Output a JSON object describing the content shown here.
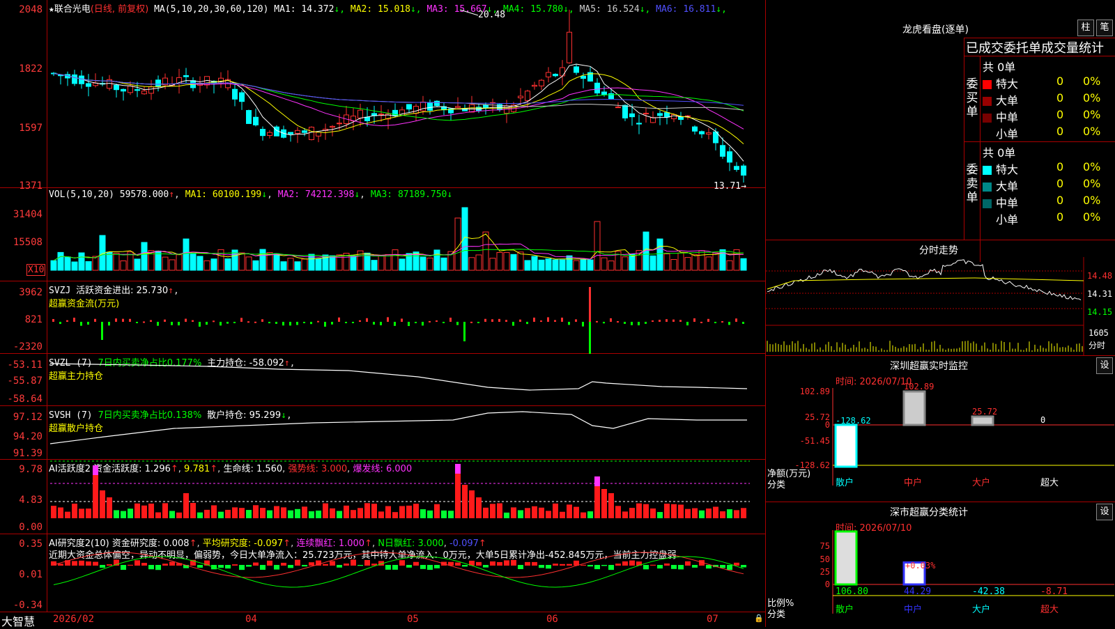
{
  "main": {
    "stock_name": "联合光电",
    "chart_mode": "(日线, 前复权)",
    "ma_label": "MA(5,10,20,30,60,120)",
    "ma_values": [
      {
        "name": "MA1",
        "value": "14.372",
        "arrow": "↓",
        "color": "#ffffff"
      },
      {
        "name": "MA2",
        "value": "15.018",
        "arrow": "↓",
        "color": "#ffff00"
      },
      {
        "name": "MA3",
        "value": "15.667",
        "arrow": "↓",
        "color": "#ff33ff"
      },
      {
        "name": "MA4",
        "value": "15.780",
        "arrow": "↓",
        "color": "#00ff00"
      },
      {
        "name": "MA5",
        "value": "16.524",
        "arrow": "↓",
        "color": "#cccccc"
      },
      {
        "name": "MA6",
        "value": "16.811",
        "arrow": "↓",
        "color": "#5050ff"
      }
    ],
    "y_ticks": [
      "2048",
      "1822",
      "1597",
      "1371"
    ],
    "high_label": "20.48",
    "low_label": "13.71"
  },
  "vol": {
    "label": "VOL(5,10,20)",
    "value": "59578.000",
    "ma1": "MA1: 60100.199",
    "ma2": "MA2: 74212.398",
    "ma3": "MA3: 87189.750",
    "y_ticks": [
      "31404",
      "15508"
    ],
    "unit": "X10"
  },
  "svzj": {
    "label": "SVZJ",
    "text": "活跃资金进出: 25.730",
    "subtitle": "超赢资金流(万元)",
    "y_ticks": [
      "3962",
      "821",
      "-2320"
    ]
  },
  "svzl": {
    "label": "SVZL (7)",
    "text1": "7日内买卖净占比0.177%",
    "text2": "主力持仓: -58.092",
    "subtitle": "超赢主力持仓",
    "y_ticks": [
      "-53.11",
      "-55.87",
      "-58.64"
    ]
  },
  "svsh": {
    "label": "SVSH (7)",
    "text1": "7日内买卖净占比0.138%",
    "text2": "散户持仓: 95.299",
    "subtitle": "超赢散户持仓",
    "y_ticks": [
      "97.12",
      "94.20",
      "91.39"
    ]
  },
  "ai1": {
    "label": "AI活跃度2",
    "v1": "资金活跃度: 1.296",
    "v2": "9.781",
    "v3": "生命线: 1.560",
    "v4": "强势线: 3.000",
    "v5": "爆发线: 6.000",
    "y_ticks": [
      "9.78",
      "4.83",
      "0.00"
    ]
  },
  "ai2": {
    "label": "AI研究度2(10)",
    "v1": "资金研究度: 0.008",
    "v2": "平均研究度: -0.097",
    "v3": "连续飘红: 1.000",
    "v4": "N日飘红: 3.000",
    "v5": "-0.097",
    "commentary": "近期大资金总体偏空，异动不明显，偏弱势，今日大单净流入：25.723万元，其中特大单净流入：0万元，大单5日累计净出-452.845万元，当前主力控盘弱",
    "y_ticks": [
      "0.35",
      "0.01",
      "-0.34"
    ]
  },
  "x_axis": {
    "app_name": "大智慧",
    "labels": [
      "2026/02",
      "04",
      "05",
      "06",
      "07"
    ]
  },
  "right": {
    "lhb_title": "龙虎看盘(逐单)",
    "btn1": "柱",
    "btn2": "笔",
    "header": "已成交委托单成交量统计",
    "buy": {
      "side": "委买单",
      "total": "共 0单",
      "rows": [
        {
          "label": "特大",
          "count": "0",
          "pct": "0%",
          "color": "#ff0000"
        },
        {
          "label": "大单",
          "count": "0",
          "pct": "0%",
          "color": "#990000"
        },
        {
          "label": "中单",
          "count": "0",
          "pct": "0%",
          "color": "#770000"
        },
        {
          "label": "小单",
          "count": "0",
          "pct": "0%",
          "color": "#000000"
        }
      ]
    },
    "sell": {
      "side": "委卖单",
      "total": "共 0单",
      "rows": [
        {
          "label": "特大",
          "count": "0",
          "pct": "0%",
          "color": "#00ffff"
        },
        {
          "label": "大单",
          "count": "0",
          "pct": "0%",
          "color": "#008888"
        },
        {
          "label": "中单",
          "count": "0",
          "pct": "0%",
          "color": "#006666"
        },
        {
          "label": "小单",
          "count": "0",
          "pct": "0%",
          "color": "#000000"
        }
      ]
    },
    "intraday": {
      "title": "分时走势",
      "prices": [
        "14.48",
        "14.31",
        "14.15"
      ],
      "vol": "1605",
      "vol_unit": "分时"
    },
    "monitor": {
      "title": "深圳超赢实时监控",
      "btn": "设",
      "date": "时间: 2026/07/10",
      "y_ticks": [
        "102.89",
        "25.72",
        "0",
        "-51.45",
        "-128.62"
      ],
      "bars": [
        {
          "cat": "散户",
          "value": -128.62,
          "label": "-128.62"
        },
        {
          "cat": "中户",
          "value": 102.89,
          "label": "102.89"
        },
        {
          "cat": "大户",
          "value": 25.72,
          "label": "25.72"
        },
        {
          "cat": "超大",
          "value": 0,
          "label": "0"
        }
      ],
      "ylabel": "净额(万元)",
      "xlabel": "分类"
    },
    "classify": {
      "title": "深市超赢分类统计",
      "btn": "设",
      "date": "时间: 2026/07/10",
      "y_ticks": [
        "75",
        "50",
        "25",
        "0"
      ],
      "bars": [
        {
          "cat": "散户",
          "value": 106.8,
          "label": "106.80",
          "color": "#00ff00"
        },
        {
          "cat": "中户",
          "value": 44.29,
          "label": "44.29",
          "color": "#3333ff"
        },
        {
          "cat": "大户",
          "value": -42.38,
          "label": "-42.38",
          "color": "#00ffff"
        },
        {
          "cat": "超大",
          "value": -8.71,
          "label": "-8.71",
          "color": "#ff3030"
        }
      ],
      "annotation": "+0.03%",
      "ylabel": "比例%",
      "xlabel": "分类"
    }
  }
}
